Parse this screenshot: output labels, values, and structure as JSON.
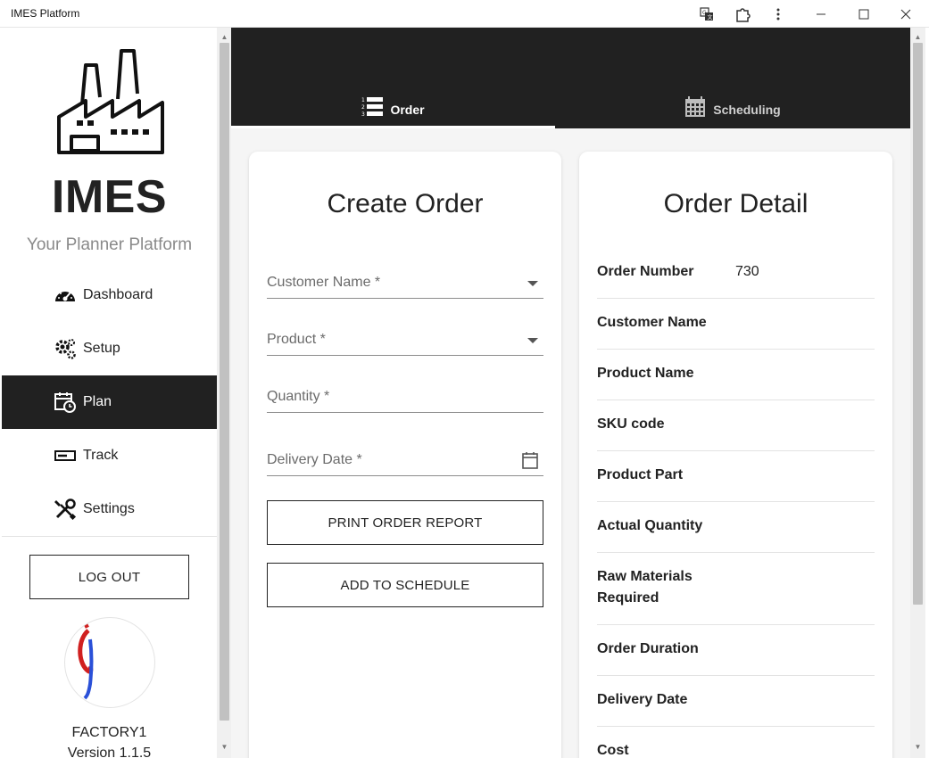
{
  "window": {
    "title": "IMES Platform",
    "icons": [
      "translate-icon",
      "extension-icon",
      "more-icon",
      "minimize-icon",
      "maximize-icon",
      "close-icon"
    ]
  },
  "sidebar": {
    "brand": "IMES",
    "tagline": "Your Planner Platform",
    "items": [
      {
        "label": "Dashboard",
        "icon": "speedometer-icon",
        "active": false
      },
      {
        "label": "Setup",
        "icon": "gears-icon",
        "active": false
      },
      {
        "label": "Plan",
        "icon": "calendar-clock-icon",
        "active": true
      },
      {
        "label": "Track",
        "icon": "track-icon",
        "active": false
      },
      {
        "label": "Settings",
        "icon": "tools-icon",
        "active": false
      }
    ],
    "logout_label": "LOG OUT",
    "factory_name": "FACTORY1",
    "version": "Version 1.1.5"
  },
  "tabs": [
    {
      "label": "Order",
      "icon": "numbered-list-icon",
      "active": true
    },
    {
      "label": "Scheduling",
      "icon": "calendar-grid-icon",
      "active": false
    }
  ],
  "create_order": {
    "title": "Create Order",
    "fields": {
      "customer": "Customer Name *",
      "product": "Product *",
      "quantity": "Quantity *",
      "delivery": "Delivery Date *"
    },
    "print_button": "PRINT ORDER REPORT",
    "schedule_button": "ADD TO SCHEDULE"
  },
  "order_detail": {
    "title": "Order Detail",
    "rows": [
      {
        "label": "Order Number",
        "value": "730"
      },
      {
        "label": "Customer Name",
        "value": ""
      },
      {
        "label": "Product Name",
        "value": ""
      },
      {
        "label": "SKU code",
        "value": ""
      },
      {
        "label": "Product Part",
        "value": ""
      },
      {
        "label": "Actual Quantity",
        "value": ""
      },
      {
        "label": "Raw Materials Required",
        "value": ""
      },
      {
        "label": "Order Duration",
        "value": ""
      },
      {
        "label": "Delivery Date",
        "value": ""
      },
      {
        "label": "Cost",
        "value": ""
      }
    ]
  },
  "colors": {
    "dark": "#212121",
    "background": "#f5f5f5",
    "muted": "#8a8a8a"
  }
}
